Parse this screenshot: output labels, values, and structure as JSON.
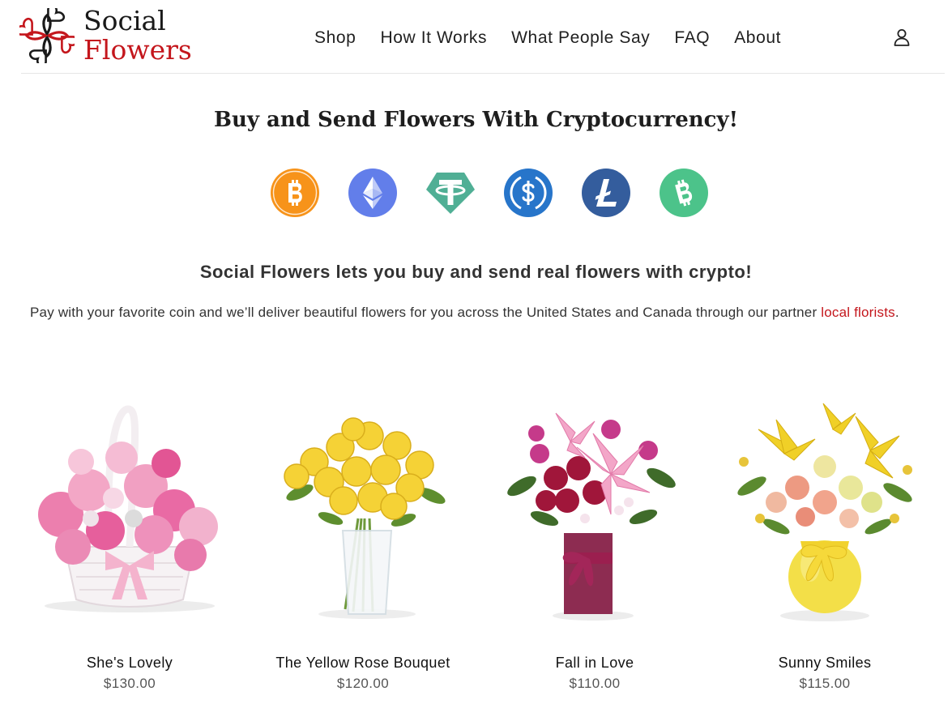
{
  "brand": {
    "line1": "Social",
    "line2": "Flowers",
    "accent_color": "#c4161c"
  },
  "nav": {
    "items": [
      {
        "label": "Shop"
      },
      {
        "label": "How It Works"
      },
      {
        "label": "What People Say"
      },
      {
        "label": "FAQ"
      },
      {
        "label": "About"
      }
    ],
    "account_icon": "user-icon"
  },
  "hero": {
    "title": "Buy and Send Flowers With Cryptocurrency!"
  },
  "coins": [
    {
      "icon": "bitcoin-icon",
      "color": "#F7931A"
    },
    {
      "icon": "ethereum-icon",
      "color": "#627EEA"
    },
    {
      "icon": "tether-icon",
      "color": "#50AF95"
    },
    {
      "icon": "usd-coin-icon",
      "color": "#2775CA"
    },
    {
      "icon": "litecoin-icon",
      "color": "#345D9D"
    },
    {
      "icon": "bitcoin-cash-icon",
      "color": "#4CC38A"
    }
  ],
  "subhead": "Social Flowers lets you buy and send real flowers with crypto!",
  "intro": {
    "text": "Pay with your favorite coin and we’ll deliver beautiful flowers for you across the United States and Canada through our partner ",
    "link": "local florists",
    "suffix": "."
  },
  "products": [
    {
      "name": "She's Lovely",
      "price": "$130.00"
    },
    {
      "name": "The Yellow Rose Bouquet",
      "price": "$120.00"
    },
    {
      "name": "Fall in Love",
      "price": "$110.00"
    },
    {
      "name": "Sunny Smiles",
      "price": "$115.00"
    }
  ]
}
